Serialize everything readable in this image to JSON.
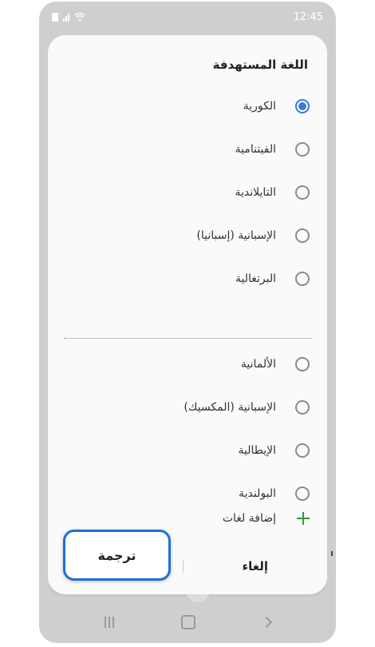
{
  "status_bar": {
    "time": "12:45"
  },
  "dialog": {
    "title": "اللغة المستهدفة",
    "languages": [
      {
        "label": "الكورية",
        "selected": true
      },
      {
        "label": "الفيتنامية",
        "selected": false
      },
      {
        "label": "التايلاندية",
        "selected": false
      },
      {
        "label": "الإسبانية (إسبانيا)",
        "selected": false
      },
      {
        "label": "البرتغالية",
        "selected": false
      },
      {
        "label": "الألمانية",
        "selected": false
      },
      {
        "label": "الإسبانية (المكسيك)",
        "selected": false
      },
      {
        "label": "الإيطالية",
        "selected": false
      },
      {
        "label": "البولندية",
        "selected": false
      }
    ],
    "add_languages_label": "إضافة لغات",
    "cancel_label": "إلغاء",
    "translate_label": "ترجمة"
  },
  "colors": {
    "accent": "#3a7bd5",
    "highlight_border": "#1e6fd9",
    "add_icon": "#2e9a43"
  }
}
